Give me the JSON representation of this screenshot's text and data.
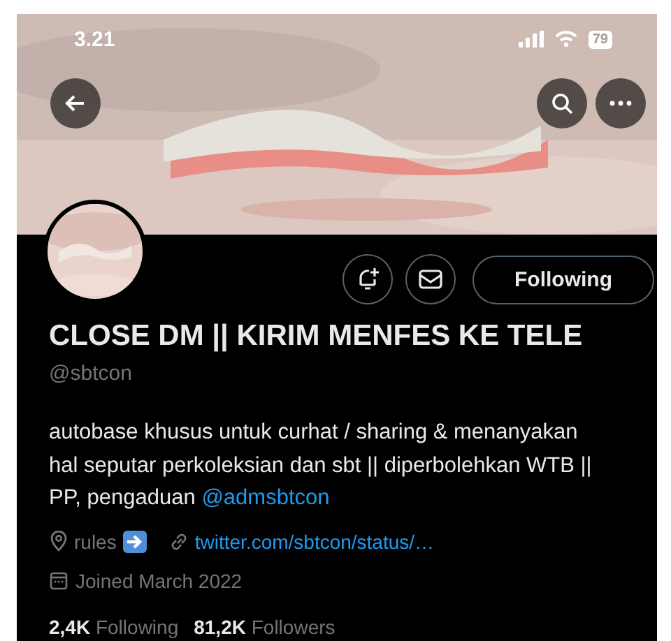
{
  "status_bar": {
    "time": "3.21",
    "battery": "79"
  },
  "actions": {
    "following_label": "Following"
  },
  "profile": {
    "name": "CLOSE DM || KIRIM MENFES KE TELE",
    "handle": "@sbtcon",
    "bio": "autobase khusus untuk curhat / sharing & menanyakan hal seputar perkoleksian dan sbt || diperbolehkan WTB || PP, pengaduan ",
    "bio_mention": "@admsbtcon",
    "location": "rules",
    "link": "twitter.com/sbtcon/status/…",
    "joined": "Joined March 2022"
  },
  "stats": [
    {
      "text": "**2,4K** Following"
    },
    {
      "text": "**81,2K** Followers"
    }
  ]
}
